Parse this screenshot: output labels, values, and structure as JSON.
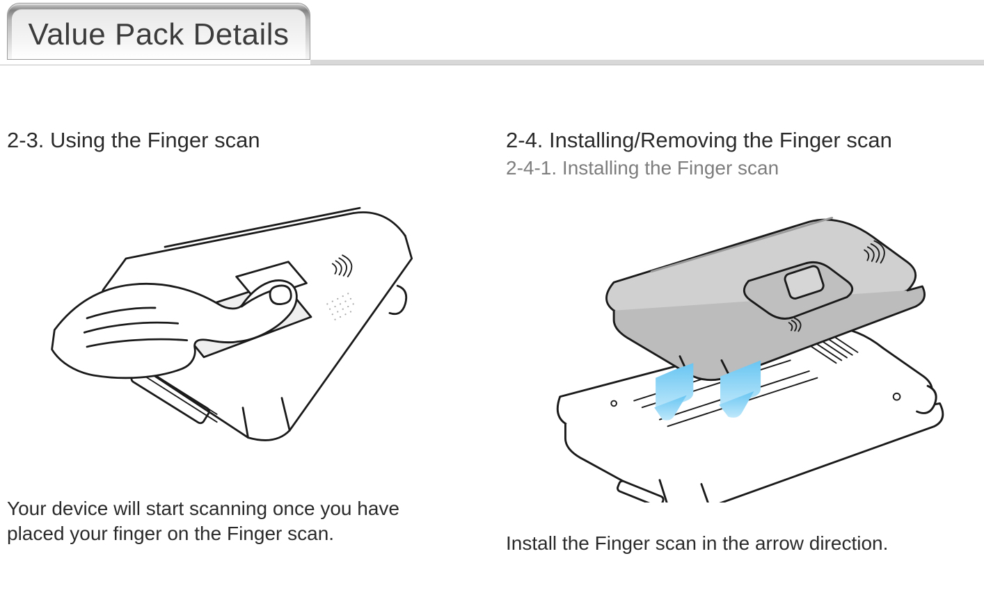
{
  "tab": {
    "label": "Value Pack Details"
  },
  "left": {
    "heading": "2-3. Using the Finger scan",
    "body": "Your device will start scanning once you have placed your finger on the Finger scan."
  },
  "right": {
    "heading": "2-4. Installing/Removing the Finger scan",
    "subheading": "2-4-1. Installing the Finger scan",
    "body": "Install the Finger scan in the arrow direction."
  }
}
